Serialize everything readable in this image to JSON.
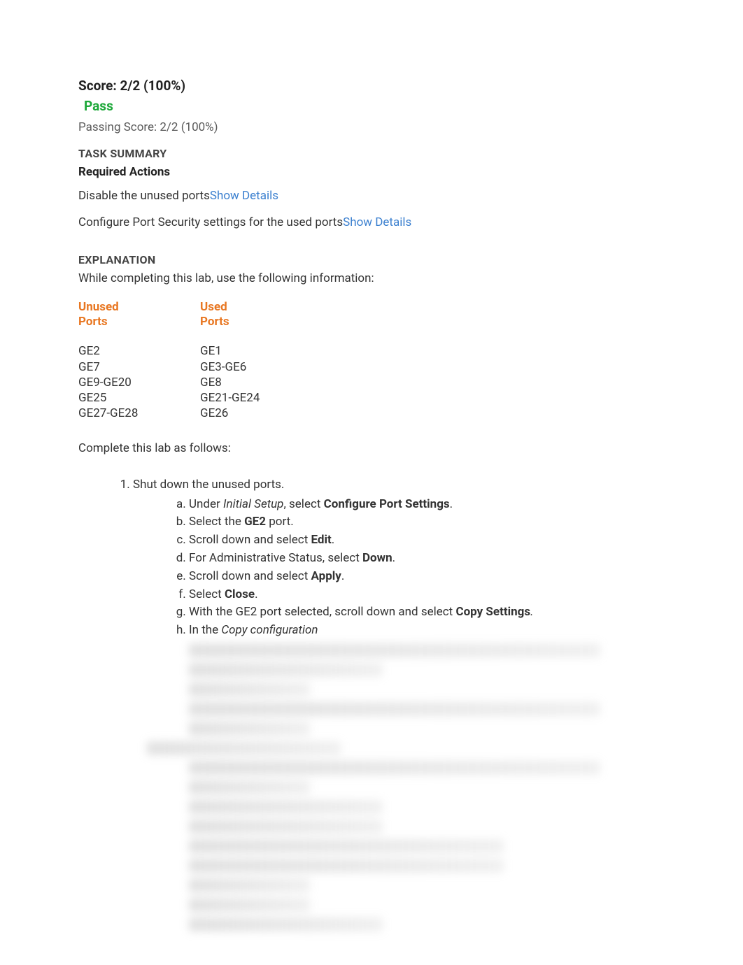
{
  "header": {
    "score_line": "Score: 2/2 (100%)",
    "pass_label": "Pass",
    "passing_score": "Passing Score: 2/2 (100%)"
  },
  "task_summary": {
    "heading": "TASK SUMMARY",
    "required_heading": "Required Actions",
    "actions": [
      {
        "text": "Disable the unused ports",
        "link": "Show Details"
      },
      {
        "text": "Configure Port Security settings for the used ports",
        "link": "Show Details"
      }
    ]
  },
  "explanation": {
    "heading": "EXPLANATION",
    "intro": "While completing this lab, use the following information:",
    "table": {
      "unused_header_l1": "Unused",
      "unused_header_l2": "Ports",
      "used_header_l1": "Used",
      "used_header_l2": "Ports",
      "unused_items": [
        "GE2",
        "GE7",
        "GE9-GE20",
        "GE25",
        "GE27-GE28"
      ],
      "used_items": [
        "GE1",
        "GE3-GE6",
        "GE8",
        "GE21-GE24",
        "GE26"
      ]
    },
    "complete_intro": "Complete this lab as follows:",
    "steps": {
      "step1_title": "Shut down the unused ports.",
      "step1_sub": {
        "a_pre": "Under ",
        "a_italic": "Initial Setup",
        "a_mid": ", select ",
        "a_bold": "Configure Port Settings",
        "a_post": ".",
        "b_pre": "Select the ",
        "b_bold": "GE2",
        "b_post": " port.",
        "c_pre": "Scroll down and select ",
        "c_bold": "Edit",
        "c_post": ".",
        "d_pre": "For Administrative Status, select ",
        "d_bold": "Down",
        "d_post": ".",
        "e_pre": "Scroll down and select ",
        "e_bold": "Apply",
        "e_post": ".",
        "f_pre": "Select ",
        "f_bold": "Close",
        "f_post": ".",
        "g_pre": "With the GE2 port selected, scroll down and select ",
        "g_bold": "Copy Settings",
        "g_post": ".",
        "h_pre": "In the ",
        "h_italic": "Copy configuration"
      }
    }
  }
}
